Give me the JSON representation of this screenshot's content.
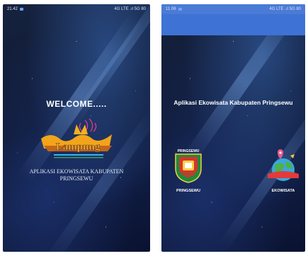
{
  "left_screen": {
    "status_time": "21.42",
    "status_right": "4G LTE .ıl 5G 80",
    "welcome": "WELCOME.....",
    "subtitle_line1": "APLIKASI EKOWISATA KABUPATEN",
    "subtitle_line2": "PRINGSEWU",
    "logo_text": "Lampung"
  },
  "right_screen": {
    "status_time": "11.06",
    "status_right": "4G LTE .ıl 5G 80",
    "title": "Aplikasi Ekowisata Kabupaten Pringsewu",
    "menu": [
      {
        "label": "PRINGSEWU",
        "emblem_caption": "PRINGSEWU"
      },
      {
        "label": "EKOWISATA"
      }
    ]
  },
  "colors": {
    "appbar": "#3e72d4",
    "background_dark": "#0d1630",
    "text": "#ffffff"
  }
}
